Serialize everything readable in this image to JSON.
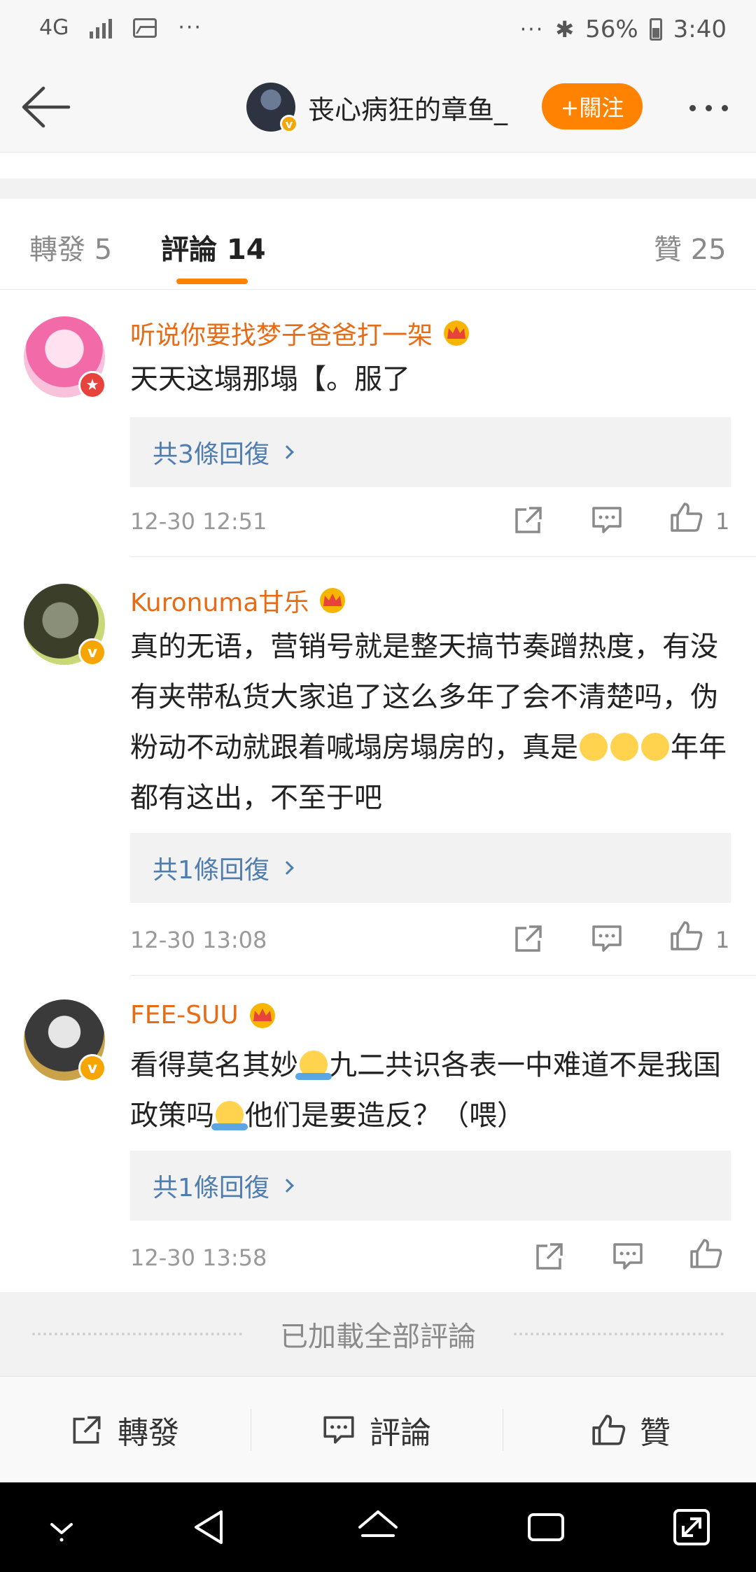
{
  "status_bar": {
    "network": "4G",
    "battery": "56%",
    "time": "3:40"
  },
  "nav": {
    "title": "丧心病狂的章鱼_",
    "follow_label": "+關注"
  },
  "tabs": [
    {
      "label": "轉發 5"
    },
    {
      "label": "評論 14"
    },
    {
      "label": "贊 25"
    }
  ],
  "comments": [
    {
      "username": "听说你要找梦子爸爸打一架",
      "text": "天天这塌那塌【。服了",
      "replies_label": "共3條回復",
      "timestamp": "12-30 12:51",
      "like_count": "1"
    },
    {
      "username": "Kuronuma甘乐",
      "text_parts": [
        "真的无语，营销号就是整天搞节奏蹭热度，有没有夹带私货大家追了这么多年了会不清楚吗，伪粉动不动就跟着喊塌房塌房的，真是",
        "年年都有这出，不至于吧"
      ],
      "replies_label": "共1條回復",
      "timestamp": "12-30 13:08",
      "like_count": "1"
    },
    {
      "username": "FEE-SUU",
      "text_parts": [
        "看得莫名其妙",
        "九二共识各表一中难道不是我国政策吗",
        "他们是要造反？（喂）"
      ],
      "replies_label": "共1條回復",
      "timestamp": "12-30 13:58",
      "like_count": ""
    }
  ],
  "loaded_all_label": "已加載全部評論",
  "action_bar": {
    "repost": "轉發",
    "comment": "評論",
    "like": "贊"
  },
  "colors": {
    "accent": "#ff8200",
    "username": "#e86b16",
    "link": "#507daf"
  }
}
